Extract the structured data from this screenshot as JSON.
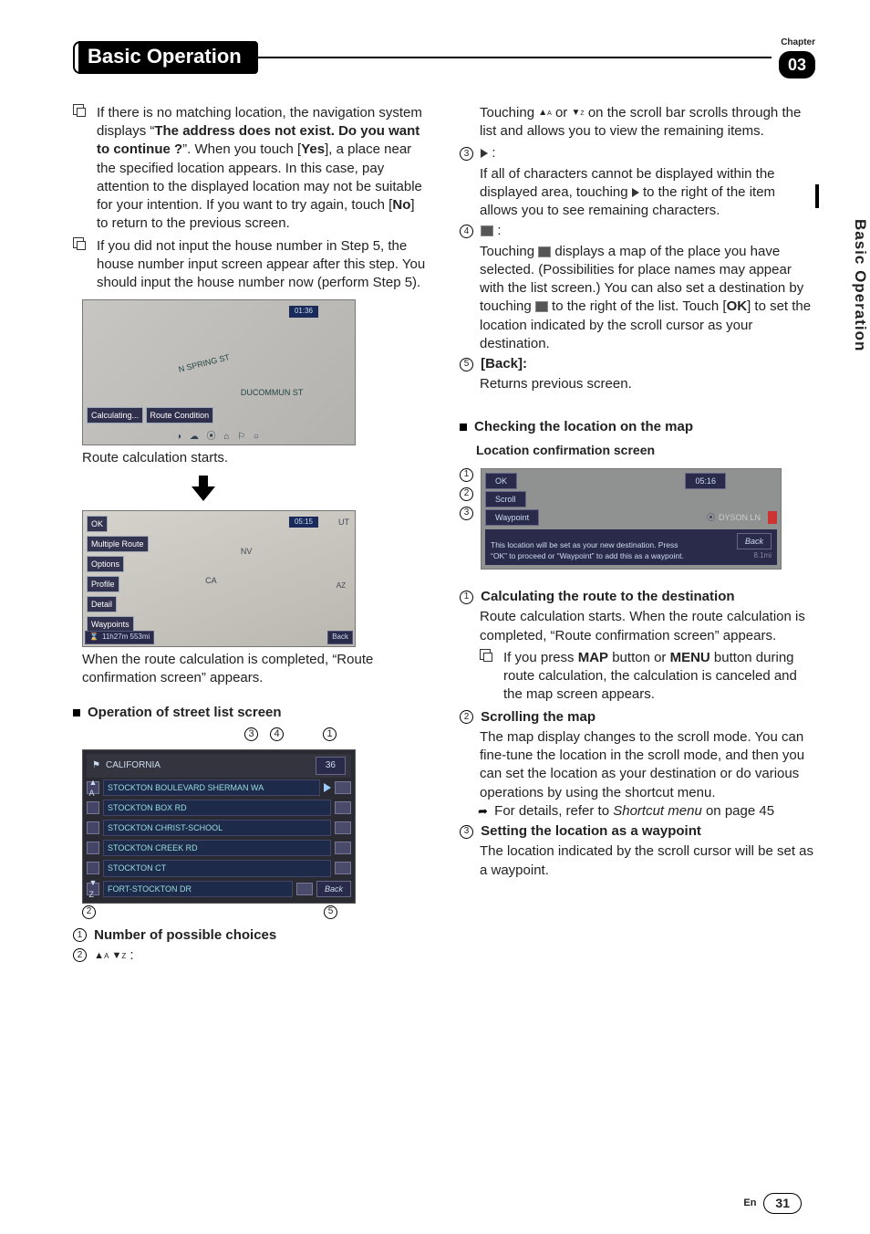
{
  "header": {
    "title": "Basic Operation",
    "chapter_label": "Chapter",
    "chapter_num": "03"
  },
  "side_tab": "Basic Operation",
  "footer": {
    "lang": "En",
    "page": "31"
  },
  "left": {
    "b1_a": "If there is no matching location, the navigation system displays “",
    "b1_b": "The address does not exist. Do you want to continue ?",
    "b1_c": "”. When you touch [",
    "b1_yes": "Yes",
    "b1_d": "], a place near the specified location appears. In this case, pay attention to the displayed location may not be suitable for your intention. If you want to try again, touch [",
    "b1_no": "No",
    "b1_e": "] to return to the previous screen.",
    "b2": "If you did not input the house number in Step 5, the house number input screen appear after this step. You should input the house number now (perform Step 5).",
    "calc_label": "Calculating...",
    "route_cond_label": "Route Condition",
    "time1": "01:36",
    "cap1": "Route calculation starts.",
    "opt_ok": "OK",
    "opt_multi": "Multiple Route",
    "opt_options": "Options",
    "opt_profile": "Profile",
    "opt_detail": "Detail",
    "opt_waypoints": "Waypoints",
    "time2": "05:15",
    "status_bar": "11h27m  553mi",
    "back_label": "Back",
    "cap2a": "When the route calculation is completed, “Route confirmation screen” appears.",
    "sec_street": "Operation of street list screen",
    "street_header": "CALIFORNIA",
    "street_count": "36",
    "streets": [
      "STOCKTON BOULEVARD SHERMAN WA",
      "STOCKTON BOX RD",
      "STOCKTON CHRIST-SCHOOL",
      "STOCKTON CREEK RD",
      "STOCKTON CT",
      "FORT-STOCKTON DR"
    ],
    "street_back": "Back",
    "c1": "Number of possible choices"
  },
  "right": {
    "scroll_text_a": "Touching ",
    "scroll_text_b": " or ",
    "scroll_text_c": " on the scroll bar scrolls through the list and allows you to view the remaining items.",
    "item3_a": "If all of characters cannot be displayed within the displayed area, touching ",
    "item3_b": " to the right of the item allows you to see remaining characters.",
    "item4_a": "Touching ",
    "item4_b": " displays a map of the place you have selected. (Possibilities for place names may appear with the list screen.) You can also set a destination by touching ",
    "item4_c": " to the right of the list. Touch [",
    "item4_ok": "OK",
    "item4_d": "] to set the location indicated by the scroll cursor as your destination.",
    "item5_label": "[Back]:",
    "item5_body": "Returns previous screen.",
    "sec_check": "Checking the location on the map",
    "sub_loc": "Location confirmation screen",
    "loc_ok": "OK",
    "loc_scroll": "Scroll",
    "loc_waypoint": "Waypoint",
    "loc_time": "05:16",
    "loc_road": "DYSON LN",
    "loc_msg": "This location will be set as your new destination. Press “OK” to proceed or “Waypoint” to add this as a waypoint.",
    "loc_back": "Back",
    "loc_dist": "8.1mi",
    "r1_h": "Calculating the route to the destination",
    "r1_b": "Route calculation starts. When the route calculation is completed, “Route confirmation screen” appears.",
    "r1_sub_a": "If you press ",
    "r1_map": "MAP",
    "r1_sub_b": " button or ",
    "r1_menu": "MENU",
    "r1_sub_c": " button during route calculation, the calculation is canceled and the map screen appears.",
    "r2_h": "Scrolling the map",
    "r2_b": "The map display changes to the scroll mode. You can fine-tune the location in the scroll mode, and then you can set the location as your destination or do various operations by using the shortcut menu.",
    "r2_ref_a": "For details, refer to ",
    "r2_ref_i": "Shortcut menu",
    "r2_ref_b": " on page 45",
    "r3_h": "Setting the location as a waypoint",
    "r3_b": "The location indicated by the scroll cursor will be set as a waypoint."
  }
}
